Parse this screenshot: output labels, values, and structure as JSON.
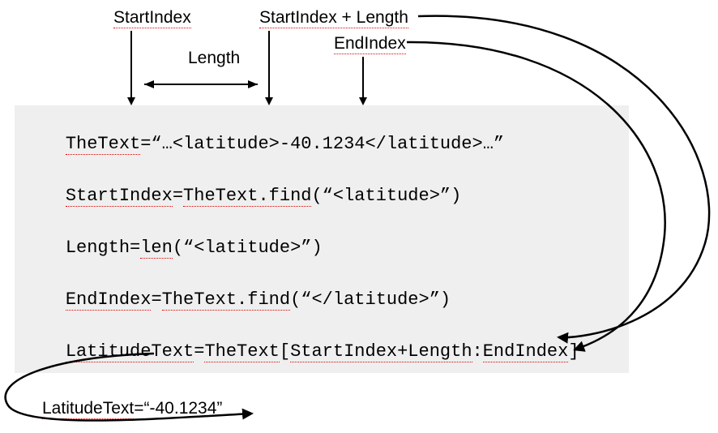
{
  "labels": {
    "startindex": "StartIndex",
    "startlen": "StartIndex + Length",
    "length": "Length",
    "endindex": "EndIndex",
    "result_prefix": "LatitudeText",
    "result_value": "=“-40.1234”"
  },
  "code": {
    "line1": {
      "a": "TheText",
      "b": "=“…<latitude>-40.1234</latitude>…”"
    },
    "line2": {
      "a": "StartIndex",
      "b": "=",
      "c": "TheText.find",
      "d": "(“<latitude>”)"
    },
    "line3": {
      "a": "Length=",
      "b": "len",
      "c": "(“<latitude>”)"
    },
    "line4": {
      "a": "EndIndex",
      "b": "=",
      "c": "TheText.find",
      "d": "(“</latitude>”)"
    },
    "line5": {
      "a": "LatitudeText",
      "b": "=",
      "c": "TheText",
      "d": "[",
      "e": "StartIndex+Length",
      "f": ":",
      "g": "EndIndex",
      "h": "]"
    }
  }
}
